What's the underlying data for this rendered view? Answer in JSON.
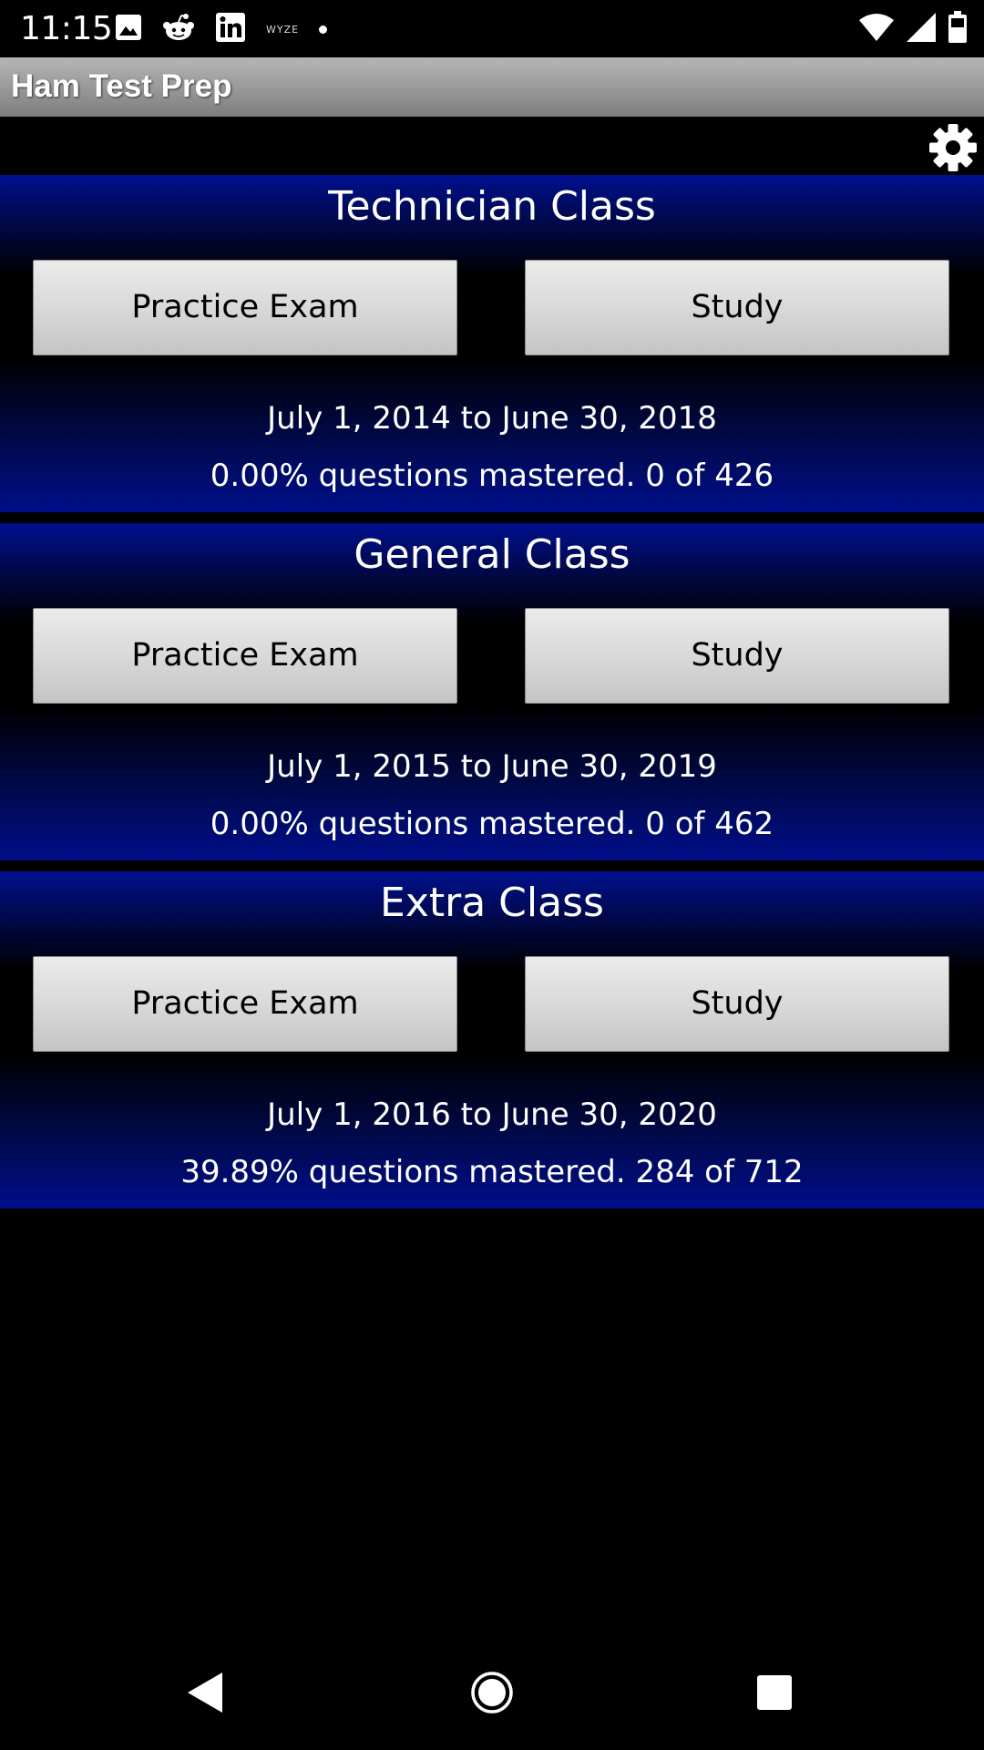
{
  "status_bar": {
    "time": "11:15",
    "left_icons": [
      "image-icon",
      "reddit-icon",
      "linkedin-icon",
      "wyze-icon",
      "notification-dot-icon"
    ],
    "wyze_label": "WYZE",
    "right_icons": [
      "wifi-icon",
      "signal-icon",
      "battery-icon"
    ]
  },
  "app": {
    "title": "Ham Test Prep",
    "settings_icon": "gear-icon"
  },
  "sections": [
    {
      "title": "Technician Class",
      "practice_label": "Practice Exam",
      "study_label": "Study",
      "dates": "July 1, 2014 to June 30, 2018",
      "progress": "0.00% questions mastered. 0 of 426"
    },
    {
      "title": "General Class",
      "practice_label": "Practice Exam",
      "study_label": "Study",
      "dates": "July 1, 2015 to June 30, 2019",
      "progress": "0.00% questions mastered. 0 of 462"
    },
    {
      "title": "Extra Class",
      "practice_label": "Practice Exam",
      "study_label": "Study",
      "dates": "July 1, 2016 to June 30, 2020",
      "progress": "39.89% questions mastered. 284 of 712"
    }
  ],
  "nav_bar": {
    "icons": [
      "back-icon",
      "home-icon",
      "recents-icon"
    ]
  },
  "colors": {
    "section_blue": "#00108f",
    "title_bar_gray": "#9a9a9a",
    "button_gray": "#d9d9d9"
  }
}
